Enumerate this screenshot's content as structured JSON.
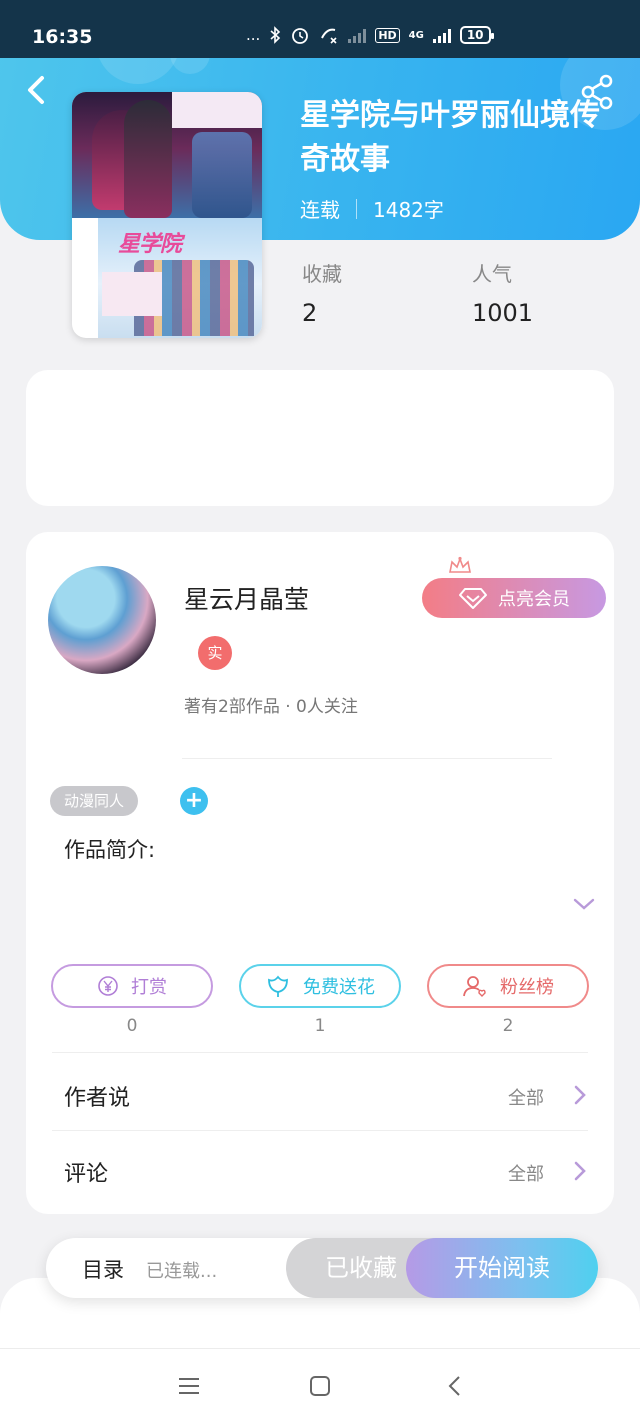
{
  "status_bar": {
    "time": "16:35",
    "dots": "...",
    "network": "4G",
    "hd": "HD",
    "battery": "10"
  },
  "book": {
    "title": "星学院与叶罗丽仙境传奇故事",
    "status": "连载",
    "word_count": "1482字",
    "stats": [
      {
        "label": "收藏",
        "value": "2"
      },
      {
        "label": "人气",
        "value": "1001"
      }
    ],
    "cover_logo": "星学院"
  },
  "author": {
    "name": "星云月晶莹",
    "verified_badge": "实",
    "stats": "著有2部作品 · 0人关注",
    "vip_button": "点亮会员"
  },
  "tags": {
    "genre": "动漫同人",
    "add": "+"
  },
  "intro": {
    "label": "作品简介:"
  },
  "actions": [
    {
      "label": "打赏",
      "count": "0",
      "icon": "yen-icon"
    },
    {
      "label": "免费送花",
      "count": "1",
      "icon": "flower-icon"
    },
    {
      "label": "粉丝榜",
      "count": "2",
      "icon": "fans-icon"
    }
  ],
  "sections": [
    {
      "title": "作者说",
      "link": "全部"
    },
    {
      "title": "评论",
      "link": "全部"
    }
  ],
  "read_bar": {
    "toc_label": "目录",
    "toc_status": "已连载...",
    "favorite_button": "已收藏",
    "read_button": "开始阅读"
  },
  "colors": {
    "header": "#38b4ef",
    "accent_blue": "#3ec0ef",
    "reward": "#b07ed6",
    "flower": "#2fbfe0",
    "fans": "#e56a6a"
  }
}
